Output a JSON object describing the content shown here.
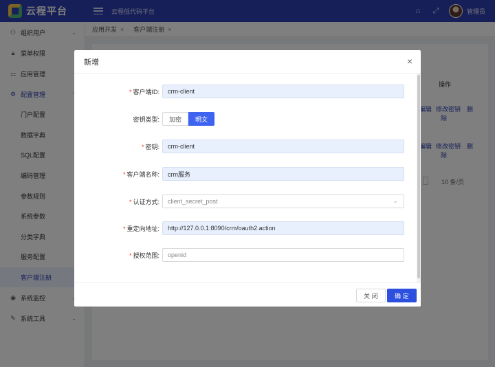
{
  "app": {
    "logo_text": "云程平台",
    "subtitle": "云程低代码平台",
    "user": "管理员"
  },
  "topbar_icons": [
    "home-icon",
    "fullscreen-icon"
  ],
  "sidebar": {
    "items": [
      {
        "label": "组织用户",
        "icon": "org-icon",
        "chevron": "⌄"
      },
      {
        "label": "菜单权限",
        "icon": "lock-icon"
      },
      {
        "label": "应用管理",
        "icon": "app-icon"
      },
      {
        "label": "配置管理",
        "icon": "gear-icon",
        "chevron": "⌃"
      }
    ],
    "sub_items": [
      "门户配置",
      "数据字典",
      "SQL配置",
      "编码管理",
      "参数规则",
      "系统参数",
      "分类字典",
      "服务配置",
      "客户端注册"
    ],
    "bottom_items": [
      {
        "label": "系统监控",
        "icon": "eye-icon",
        "chevron": "⌄"
      },
      {
        "label": "系统工具",
        "icon": "wrench-icon",
        "chevron": "⌄"
      }
    ]
  },
  "tabs": [
    {
      "label": "应用开发",
      "close": "×"
    },
    {
      "label": "客户端注册",
      "close": "×"
    }
  ],
  "background": {
    "col_operation": "操作",
    "row1_edit": "编辑",
    "row1_pw": "修改密钥",
    "row1_del": "删",
    "row1_del2": "除",
    "row2_edit": "编辑",
    "row2_pw": "修改密钥",
    "row2_del": "删",
    "row2_del2": "除",
    "page_size": "10 条/页"
  },
  "modal": {
    "title": "新增",
    "close": "×",
    "fields": {
      "client_id": {
        "label": "客户端ID:",
        "value": "crm-client"
      },
      "key_type": {
        "label": "密钥类型:",
        "options": [
          "加密",
          "明文"
        ],
        "selected": "明文"
      },
      "secret": {
        "label": "密钥:",
        "value": "crm-client"
      },
      "client_name": {
        "label": "客户端名称:",
        "value": "crm服务"
      },
      "auth_method": {
        "label": "认证方式:",
        "placeholder": "client_secret_post"
      },
      "redirect": {
        "label": "重定向地址:",
        "value": "http://127.0.0.1:8090/crm/oauth2.action"
      },
      "scope": {
        "label": "授权范围:",
        "placeholder": "openid"
      }
    },
    "footer": {
      "close_label": "关 闭",
      "ok_label": "确 定"
    }
  }
}
